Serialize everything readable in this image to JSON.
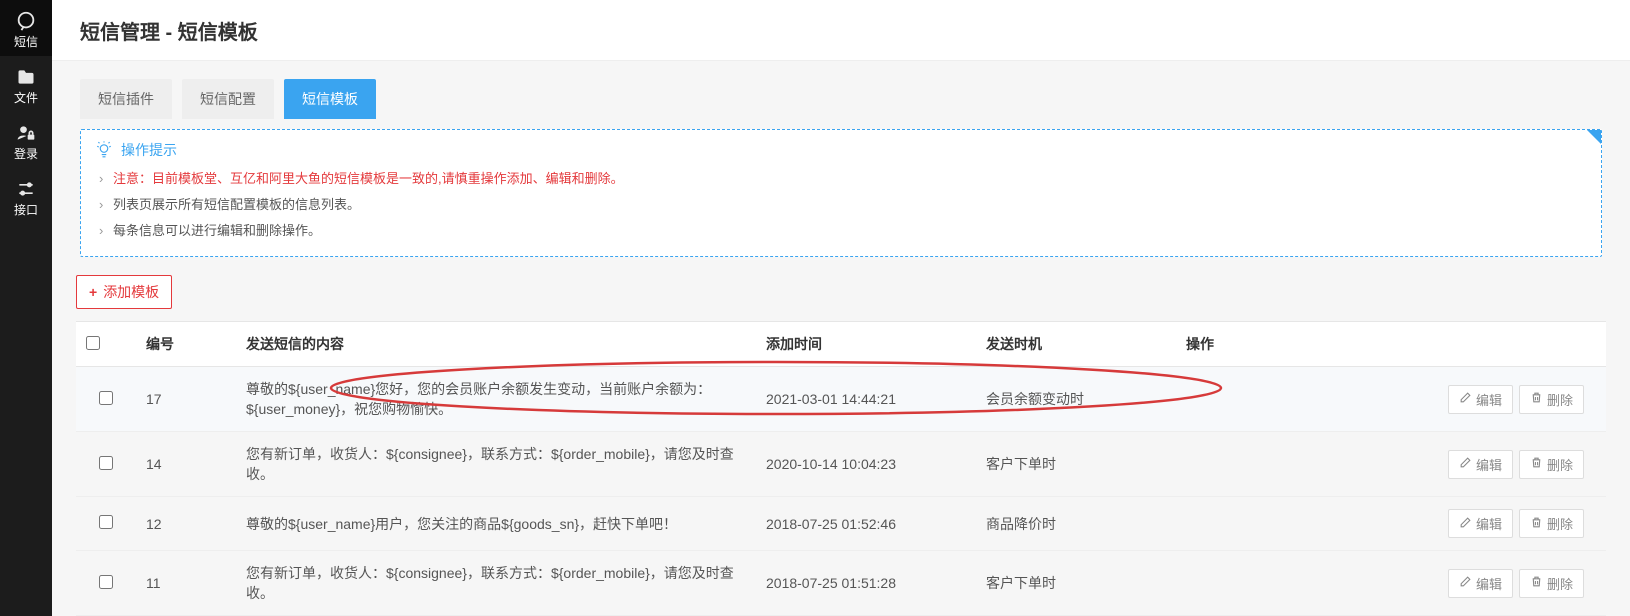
{
  "sidebar": {
    "items": [
      {
        "label": "短信"
      },
      {
        "label": "文件"
      },
      {
        "label": "登录"
      },
      {
        "label": "接口"
      }
    ]
  },
  "page": {
    "title": "短信管理 - 短信模板"
  },
  "tabs": [
    {
      "label": "短信插件",
      "active": false
    },
    {
      "label": "短信配置",
      "active": false
    },
    {
      "label": "短信模板",
      "active": true
    }
  ],
  "tips": {
    "heading": "操作提示",
    "items": [
      {
        "text": "注意：目前模板堂、互亿和阿里大鱼的短信模板是一致的,请慎重操作添加、编辑和删除。",
        "red": true
      },
      {
        "text": "列表页展示所有短信配置模板的信息列表。",
        "red": false
      },
      {
        "text": "每条信息可以进行编辑和删除操作。",
        "red": false
      }
    ]
  },
  "add_button": "添加模板",
  "table": {
    "headers": {
      "id": "编号",
      "content": "发送短信的内容",
      "time": "添加时间",
      "trigger": "发送时机",
      "ops": "操作"
    },
    "btn_edit": "编辑",
    "btn_del": "删除",
    "rows": [
      {
        "id": "17",
        "content": "尊敬的${user_name}您好，您的会员账户余额发生变动，当前账户余额为：${user_money}，祝您购物愉快。",
        "time": "2021-03-01 14:44:21",
        "trigger": "会员余额变动时",
        "hl": true
      },
      {
        "id": "14",
        "content": "您有新订单，收货人：${consignee}，联系方式：${order_mobile}，请您及时查收。",
        "time": "2020-10-14 10:04:23",
        "trigger": "客户下单时",
        "hl": false
      },
      {
        "id": "12",
        "content": "尊敬的${user_name}用户，您关注的商品${goods_sn}，赶快下单吧！",
        "time": "2018-07-25 01:52:46",
        "trigger": "商品降价时",
        "hl": false
      },
      {
        "id": "11",
        "content": "您有新订单，收货人：${consignee}，联系方式：${order_mobile}，请您及时查收。",
        "time": "2018-07-25 01:51:28",
        "trigger": "客户下单时",
        "hl": false
      }
    ]
  }
}
